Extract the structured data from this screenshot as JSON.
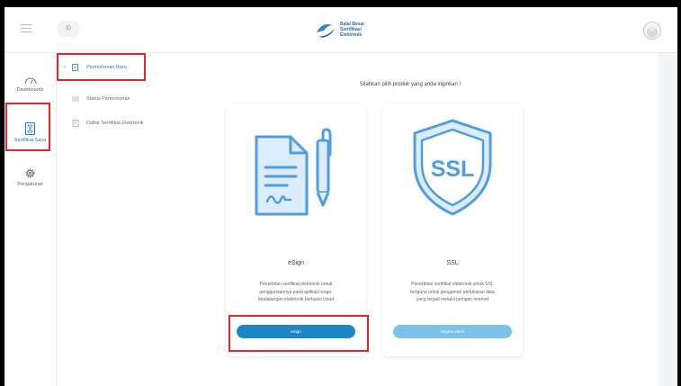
{
  "header": {
    "lang_label": "ID",
    "logo": {
      "line1": "Balai Besar",
      "line2": "Sertifikasi",
      "line3": "Elektronik"
    }
  },
  "rail": {
    "items": [
      {
        "label": "Dashboards",
        "icon": "gauge-icon"
      },
      {
        "label": "Sertifikat Saya",
        "icon": "certificate-icon"
      },
      {
        "label": "Pengaturan",
        "icon": "gear-icon"
      }
    ]
  },
  "submenu": {
    "items": [
      {
        "label": "Permohonan Baru",
        "icon": "new-request-icon"
      },
      {
        "label": "Status Permohonan",
        "icon": "status-icon"
      },
      {
        "label": "Daftar Sertifikat Elektronik",
        "icon": "document-list-icon"
      }
    ]
  },
  "main": {
    "prompt": "Silahkan pilih produk yang anda inginkan !",
    "cards": [
      {
        "title": "eSign",
        "desc_lines": [
          "Penerbitan sertifikat elektronik untuk",
          "penggunaannya pada aplikasi esign,",
          "tandatangan elektronik berbasis cloud"
        ],
        "button_label": "eSign",
        "icon": "document-signature-icon"
      },
      {
        "title": "SSL",
        "desc_lines": [
          "Penerbitan sertifikat elektronik untuk SSL",
          "berguna untuk pengaman pertukaran data",
          "yang terjadi melalui jaringan internet"
        ],
        "button_label": "Segera Hadir",
        "icon": "ssl-shield-icon",
        "icon_text": "SSL"
      }
    ]
  },
  "colors": {
    "accent": "#1f86c6",
    "icon_blue": "#4e9ee0",
    "highlight_red": "#e3262c"
  }
}
